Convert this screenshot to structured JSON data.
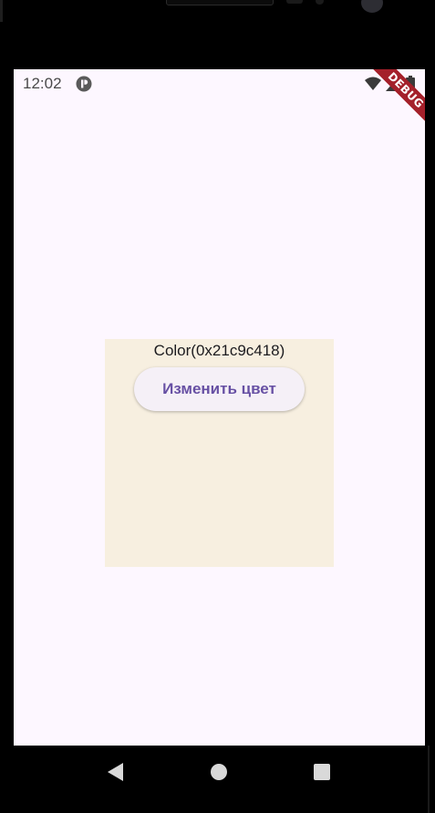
{
  "status_bar": {
    "time": "12:02",
    "notification_icon": "app-notification-icon",
    "wifi_icon": "wifi-icon",
    "signal_icon": "signal-icon",
    "battery_icon": "battery-icon"
  },
  "debug_banner": {
    "label": "DEBUG",
    "color": "#a4202a"
  },
  "content": {
    "color_label": "Color(0x21c9c418)",
    "box_color": "#f7efe0",
    "button_label": "Изменить цвет",
    "button_text_color": "#6750a4"
  },
  "nav_bar": {
    "back_icon": "back-triangle-icon",
    "home_icon": "home-circle-icon",
    "recents_icon": "recents-square-icon"
  },
  "colors": {
    "screen_background": "#fdf7ff",
    "bezel": "#000000"
  }
}
